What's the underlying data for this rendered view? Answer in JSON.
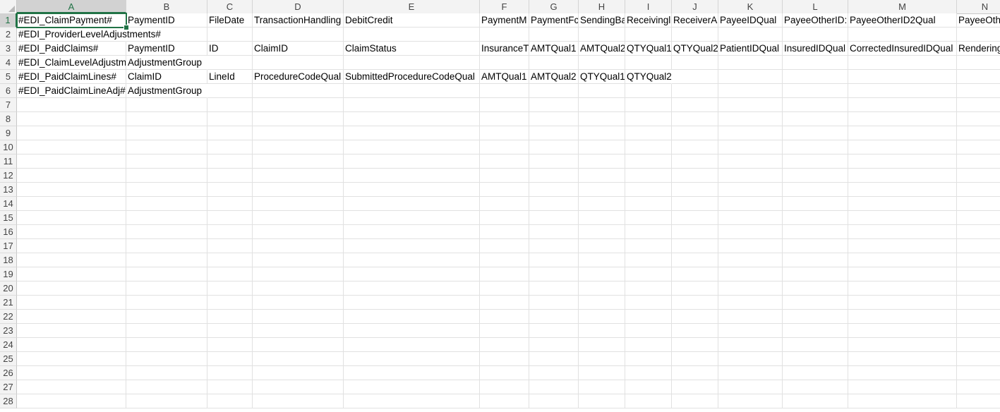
{
  "columns": [
    "A",
    "B",
    "C",
    "D",
    "E",
    "F",
    "G",
    "H",
    "I",
    "J",
    "K",
    "L",
    "M",
    "N"
  ],
  "row_numbers": [
    "1",
    "2",
    "3",
    "4",
    "5",
    "6",
    "7",
    "8",
    "9",
    "10",
    "11",
    "12",
    "13",
    "14",
    "15",
    "16",
    "17",
    "18",
    "19",
    "20",
    "21",
    "22",
    "23",
    "24",
    "25",
    "26",
    "27",
    "28"
  ],
  "active_cell": "A1",
  "rows": [
    [
      "#EDI_ClaimPayment#",
      "PaymentID",
      "FileDate",
      "TransactionHandling",
      "DebitCredit",
      "PaymentM",
      "PaymentFc",
      "SendingBa",
      "Receivingl",
      "ReceiverA",
      "PayeeIDQual",
      "PayeeOtherID:",
      "PayeeOtherID2Qual",
      "PayeeOth"
    ],
    [
      "#EDI_ProviderLevelAdjustments#",
      "",
      "",
      "",
      "",
      "",
      "",
      "",
      "",
      "",
      "",
      "",
      "",
      ""
    ],
    [
      "#EDI_PaidClaims#",
      "PaymentID",
      "ID",
      "ClaimID",
      "ClaimStatus",
      "InsuranceT",
      "AMTQual1",
      "AMTQual2",
      "QTYQual1",
      "QTYQual2",
      "PatientIDQual",
      "InsuredIDQual",
      "CorrectedInsuredIDQual",
      "Rendering"
    ],
    [
      "#EDI_ClaimLevelAdjustm",
      "AdjustmentGroup",
      "",
      "",
      "",
      "",
      "",
      "",
      "",
      "",
      "",
      "",
      "",
      ""
    ],
    [
      "#EDI_PaidClaimLines#",
      "ClaimID",
      "LineId",
      "ProcedureCodeQual",
      "SubmittedProcedureCodeQual",
      "AMTQual1",
      "AMTQual2",
      "QTYQual1",
      "QTYQual2",
      "",
      "",
      "",
      "",
      ""
    ],
    [
      "#EDI_PaidClaimLineAdj#",
      "AdjustmentGroup",
      "",
      "",
      "",
      "",
      "",
      "",
      "",
      "",
      "",
      "",
      "",
      ""
    ]
  ]
}
